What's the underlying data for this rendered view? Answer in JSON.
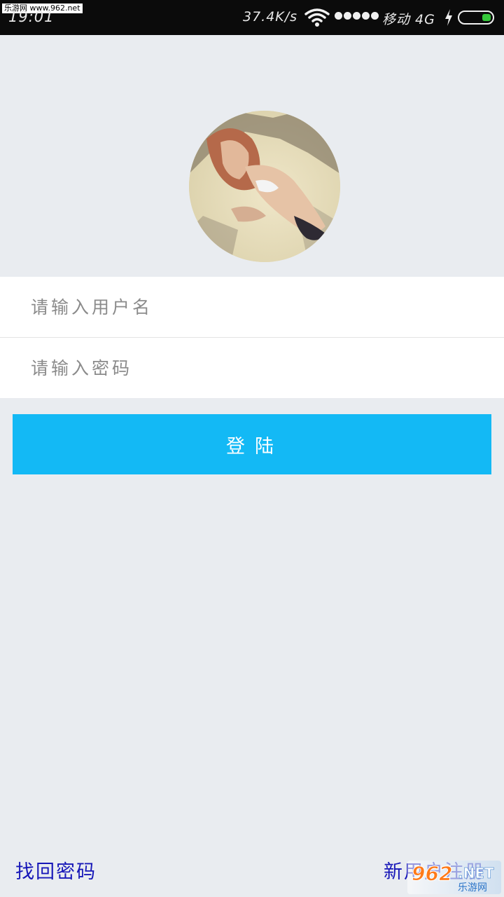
{
  "status_bar": {
    "watermark": "乐游网 www.962.net",
    "time": "19:01",
    "net_speed": "37.4K/s",
    "carrier": "移动 4G",
    "wifi_icon": "wifi-icon",
    "signal_icon": "signal-dots-icon",
    "charging_icon": "charging-bolt-icon",
    "battery_icon": "battery-icon",
    "battery_color": "#35c83a"
  },
  "avatar": {
    "description_icon": "user-avatar"
  },
  "form": {
    "username_placeholder": "请输入用户名",
    "password_placeholder": "请输入密码"
  },
  "login_button": {
    "label": "登陆",
    "color": "#13b9f5"
  },
  "links": {
    "forgot_password": "找回密码",
    "register": "新用户注册"
  },
  "site_watermark": {
    "number": "962",
    "suffix": ".NET",
    "cn": "乐游网"
  }
}
